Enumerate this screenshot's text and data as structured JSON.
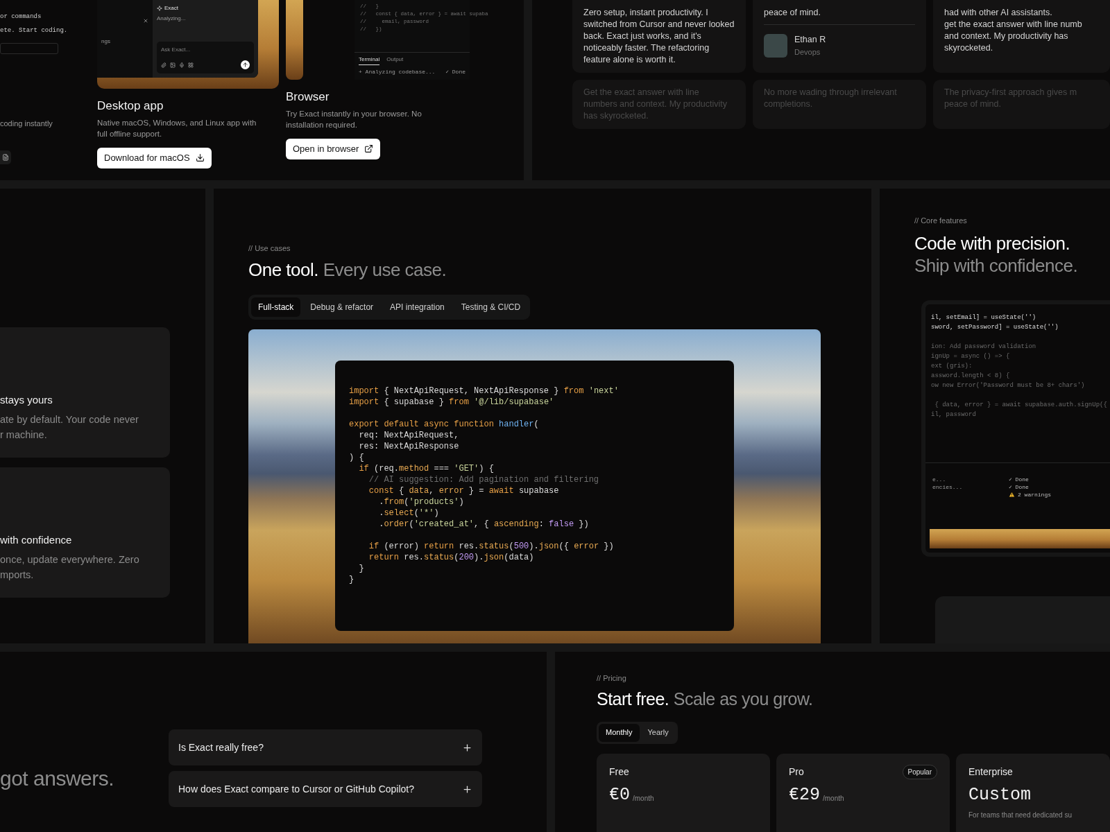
{
  "top_left": {
    "partial_column": {
      "code_lines": [
        "or commands",
        "ete. Start coding."
      ],
      "caption": "coding instantly"
    },
    "platforms": [
      {
        "kind": "desktop",
        "title": "Desktop app",
        "description": "Native macOS, Windows, and Linux app with full offline support.",
        "button": "Download for macOS",
        "preview": {
          "sidebar_text": "ngs",
          "assistant_name": "Exact",
          "status": "Analyzing...",
          "input_placeholder": "Ask Exact..."
        }
      },
      {
        "kind": "browser",
        "title": "Browser",
        "description": "Try Exact instantly in your browser. No installation required.",
        "button": "Open in browser",
        "preview": {
          "code_lines": [
            "//   }",
            "//   const { data, error } = await supaba",
            "//     email, password",
            "//   })"
          ],
          "terminal_tabs": [
            {
              "label": "Terminal",
              "selected": true
            },
            {
              "label": "Output",
              "selected": false
            }
          ],
          "terminal_rows": [
            {
              "task": "+ Analyzing codebase...",
              "result": "✓ Done"
            }
          ]
        }
      }
    ]
  },
  "testimonials": {
    "rows": [
      {
        "faded": false,
        "cards": [
          {
            "text": "Zero setup, instant productivity. I switched from Cursor and never looked back. Exact just works, and it's noticeably faster. The refactoring feature alone is worth it."
          },
          {
            "lines": [
              "peace of mind."
            ],
            "author": {
              "name": "Ethan R",
              "role": "Devops"
            }
          },
          {
            "lines": [
              "had with other AI assistants.",
              "get the exact answer with line numb",
              "and context. My productivity has",
              "skyrocketed."
            ]
          }
        ]
      },
      {
        "faded": true,
        "cards": [
          {
            "text": "Get the exact answer with line numbers and context. My productivity has skyrocketed."
          },
          {
            "text": "No more wading through irrelevant completions."
          },
          {
            "lines": [
              "The privacy-first approach gives m",
              "peace of mind."
            ]
          }
        ]
      }
    ]
  },
  "features": {
    "cards": [
      {
        "title": "stays yours",
        "lines": [
          "ate by default. Your code never",
          "r machine."
        ]
      },
      {
        "title": "with confidence",
        "lines": [
          "once, update everywhere. Zero",
          "mports."
        ]
      }
    ]
  },
  "use_cases": {
    "eyebrow": "// Use cases",
    "heading": "One tool.",
    "heading_muted": "Every use case.",
    "tabs": [
      {
        "label": "Full-stack",
        "selected": true
      },
      {
        "label": "Debug & refactor",
        "selected": false
      },
      {
        "label": "API integration",
        "selected": false
      },
      {
        "label": "Testing & CI/CD",
        "selected": false
      }
    ],
    "code_blocks": [
      {
        "lines": [
          [
            {
              "kind": "kw",
              "text": "import"
            },
            {
              "kind": "plain",
              "text": " { NextApiRequest, NextApiResponse } "
            },
            {
              "kind": "kw",
              "text": "from"
            },
            {
              "kind": "str",
              "text": " 'next'"
            }
          ],
          [
            {
              "kind": "kw",
              "text": "import"
            },
            {
              "kind": "plain",
              "text": " { supabase } "
            },
            {
              "kind": "kw",
              "text": "from"
            },
            {
              "kind": "str",
              "text": " '@/lib/supabase'"
            }
          ]
        ]
      },
      {
        "lines": [
          [
            {
              "kind": "kw",
              "text": "export default async function"
            },
            {
              "kind": "fn",
              "text": " handler"
            },
            {
              "kind": "plain",
              "text": "("
            }
          ],
          [
            {
              "kind": "plain",
              "text": "  req: NextApiRequest,"
            }
          ],
          [
            {
              "kind": "plain",
              "text": "  res: NextApiResponse"
            }
          ],
          [
            {
              "kind": "plain",
              "text": ") {"
            }
          ],
          [
            {
              "kind": "kw",
              "text": "  if"
            },
            {
              "kind": "plain",
              "text": " (req."
            },
            {
              "kind": "prop",
              "text": "method"
            },
            {
              "kind": "plain",
              "text": " === "
            },
            {
              "kind": "str",
              "text": "'GET'"
            },
            {
              "kind": "plain",
              "text": ") {"
            }
          ],
          [
            {
              "kind": "cm",
              "text": "    // AI suggestion: Add pagination and filtering"
            }
          ],
          [
            {
              "kind": "kw",
              "text": "    const"
            },
            {
              "kind": "plain",
              "text": " { "
            },
            {
              "kind": "prop",
              "text": "data"
            },
            {
              "kind": "plain",
              "text": ", "
            },
            {
              "kind": "prop",
              "text": "error"
            },
            {
              "kind": "plain",
              "text": " } = "
            },
            {
              "kind": "kw",
              "text": "await"
            },
            {
              "kind": "plain",
              "text": " supabase"
            }
          ],
          [
            {
              "kind": "plain",
              "text": "      ."
            },
            {
              "kind": "prop",
              "text": "from"
            },
            {
              "kind": "plain",
              "text": "("
            },
            {
              "kind": "str",
              "text": "'products'"
            },
            {
              "kind": "plain",
              "text": ")"
            }
          ],
          [
            {
              "kind": "plain",
              "text": "      ."
            },
            {
              "kind": "prop",
              "text": "select"
            },
            {
              "kind": "plain",
              "text": "("
            },
            {
              "kind": "str",
              "text": "'*'"
            },
            {
              "kind": "plain",
              "text": ")"
            }
          ],
          [
            {
              "kind": "plain",
              "text": "      ."
            },
            {
              "kind": "prop",
              "text": "order"
            },
            {
              "kind": "plain",
              "text": "("
            },
            {
              "kind": "str",
              "text": "'created_at'"
            },
            {
              "kind": "plain",
              "text": ", { "
            },
            {
              "kind": "prop",
              "text": "ascending"
            },
            {
              "kind": "plain",
              "text": ": "
            },
            {
              "kind": "num",
              "text": "false"
            },
            {
              "kind": "plain",
              "text": " })"
            }
          ]
        ]
      },
      {
        "lines": [
          [
            {
              "kind": "kw",
              "text": "    if"
            },
            {
              "kind": "plain",
              "text": " (error) "
            },
            {
              "kind": "kw",
              "text": "return"
            },
            {
              "kind": "plain",
              "text": " res."
            },
            {
              "kind": "prop",
              "text": "status"
            },
            {
              "kind": "plain",
              "text": "("
            },
            {
              "kind": "num",
              "text": "500"
            },
            {
              "kind": "plain",
              "text": ")."
            },
            {
              "kind": "prop",
              "text": "json"
            },
            {
              "kind": "plain",
              "text": "({ "
            },
            {
              "kind": "prop",
              "text": "error"
            },
            {
              "kind": "plain",
              "text": " })"
            }
          ],
          [
            {
              "kind": "kw",
              "text": "    return"
            },
            {
              "kind": "plain",
              "text": " res."
            },
            {
              "kind": "prop",
              "text": "status"
            },
            {
              "kind": "plain",
              "text": "("
            },
            {
              "kind": "num",
              "text": "200"
            },
            {
              "kind": "plain",
              "text": ")."
            },
            {
              "kind": "prop",
              "text": "json"
            },
            {
              "kind": "plain",
              "text": "(data)"
            }
          ],
          [
            {
              "kind": "plain",
              "text": "  }"
            }
          ],
          [
            {
              "kind": "plain",
              "text": "}"
            }
          ]
        ]
      }
    ]
  },
  "core_features": {
    "eyebrow": "// Core features",
    "heading": "Code with precision.",
    "heading_muted": "Ship with confidence.",
    "code_blocks": [
      {
        "lines": [
          {
            "text": "il, setEmail] = useState('')",
            "dim": false
          },
          {
            "text": "sword, setPassword] = useState('')",
            "dim": false
          }
        ]
      },
      {
        "lines": [
          {
            "text": "ion: Add password validation",
            "dim": true
          },
          {
            "text": "ignUp = async () => {",
            "dim": true
          },
          {
            "text": "ext (gris):",
            "dim": true
          },
          {
            "text": "assword.length < 8) {",
            "dim": true
          },
          {
            "text": "ow new Error('Password must be 8+ chars')",
            "dim": true
          }
        ]
      },
      {
        "lines": [
          {
            "text": " { data, error } = await supabase.auth.signUp({",
            "dim": true
          },
          {
            "text": "il, password",
            "dim": true
          }
        ]
      }
    ],
    "terminal": {
      "tasks": [
        "e...",
        "encies..."
      ],
      "results": [
        {
          "kind": "check",
          "text": "✓ Done"
        },
        {
          "kind": "check",
          "text": "✓ Done"
        },
        {
          "kind": "warning",
          "text": "2 warnings"
        }
      ]
    }
  },
  "faq": {
    "heading_muted": "got answers.",
    "items": [
      {
        "question": "Is Exact really free?",
        "expanded": false
      },
      {
        "question": "How does Exact compare to Cursor or GitHub Copilot?",
        "expanded": false
      }
    ]
  },
  "pricing": {
    "eyebrow": "// Pricing",
    "heading": "Start free.",
    "heading_muted": "Scale as you grow.",
    "billing": [
      {
        "label": "Monthly",
        "selected": true
      },
      {
        "label": "Yearly",
        "selected": false
      }
    ],
    "plans": [
      {
        "name": "Free",
        "price": "€0",
        "period": "/month"
      },
      {
        "name": "Pro",
        "badge": "Popular",
        "price": "€29",
        "period": "/month"
      },
      {
        "name": "Enterprise",
        "price": "Custom",
        "description": "For teams that need dedicated su"
      }
    ]
  }
}
